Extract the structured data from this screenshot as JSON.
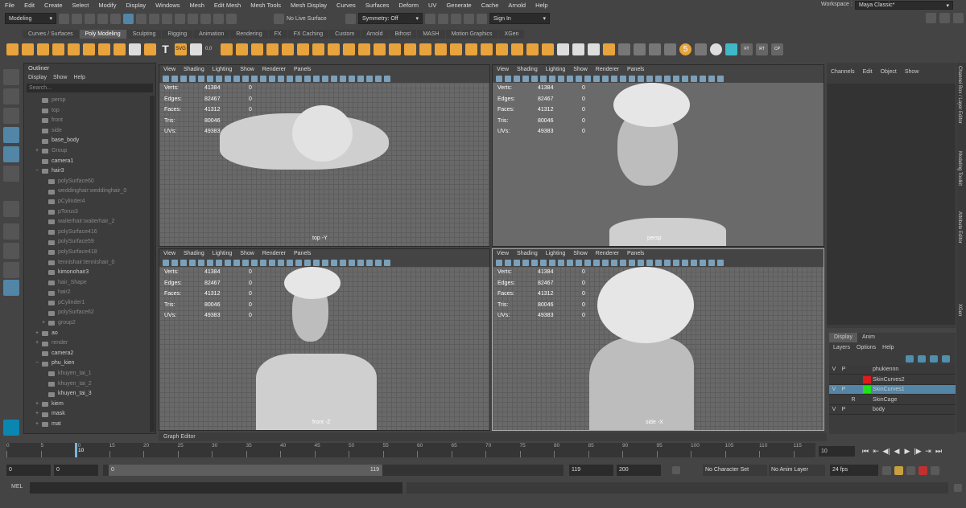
{
  "menubar": [
    "File",
    "Edit",
    "Create",
    "Select",
    "Modify",
    "Display",
    "Windows",
    "Mesh",
    "Edit Mesh",
    "Mesh Tools",
    "Mesh Display",
    "Curves",
    "Surfaces",
    "Deform",
    "UV",
    "Generate",
    "Cache",
    "Arnold",
    "Help"
  ],
  "workspace": {
    "label": "Workspace :",
    "value": "Maya Classic*"
  },
  "statusline": {
    "mode": "Modeling",
    "live_surface": "No Live Surface",
    "symmetry": "Symmetry: Off",
    "signin": "Sign In"
  },
  "shelf_tabs": [
    {
      "label": "Curves / Surfaces",
      "active": false
    },
    {
      "label": "Poly Modeling",
      "active": true
    },
    {
      "label": "Sculpting",
      "active": false
    },
    {
      "label": "Rigging",
      "active": false
    },
    {
      "label": "Animation",
      "active": false
    },
    {
      "label": "Rendering",
      "active": false
    },
    {
      "label": "FX",
      "active": false
    },
    {
      "label": "FX Caching",
      "active": false
    },
    {
      "label": "Custom",
      "active": false
    },
    {
      "label": "Arnold",
      "active": false
    },
    {
      "label": "Bifrost",
      "active": false
    },
    {
      "label": "MASH",
      "active": false
    },
    {
      "label": "Motion Graphics",
      "active": false
    },
    {
      "label": "XGen",
      "active": false
    }
  ],
  "shelf_text": {
    "svg": "SVG",
    "num": "0,0",
    "five": "5",
    "ft": "FT",
    "rt": "RT",
    "cp": "CP"
  },
  "outliner": {
    "title": "Outliner",
    "menu": [
      "Display",
      "Show",
      "Help"
    ],
    "search_placeholder": "Search...",
    "items": [
      {
        "label": "persp",
        "indent": 1,
        "dim": true,
        "expand": ""
      },
      {
        "label": "top",
        "indent": 1,
        "dim": true,
        "expand": ""
      },
      {
        "label": "front",
        "indent": 1,
        "dim": true,
        "expand": ""
      },
      {
        "label": "side",
        "indent": 1,
        "dim": true,
        "expand": ""
      },
      {
        "label": "base_body",
        "indent": 1,
        "dim": false,
        "expand": ""
      },
      {
        "label": "Group",
        "indent": 1,
        "dim": true,
        "expand": "+"
      },
      {
        "label": "camera1",
        "indent": 1,
        "dim": false,
        "expand": ""
      },
      {
        "label": "hair3",
        "indent": 1,
        "dim": false,
        "expand": "−"
      },
      {
        "label": "polySurface60",
        "indent": 2,
        "dim": true,
        "expand": ""
      },
      {
        "label": "weddinghair:weddinghair_0",
        "indent": 2,
        "dim": true,
        "expand": ""
      },
      {
        "label": "pCylinder4",
        "indent": 2,
        "dim": true,
        "expand": ""
      },
      {
        "label": "pTorus3",
        "indent": 2,
        "dim": true,
        "expand": ""
      },
      {
        "label": "waiterhair:waiterhair_2",
        "indent": 2,
        "dim": true,
        "expand": ""
      },
      {
        "label": "polySurface416",
        "indent": 2,
        "dim": true,
        "expand": ""
      },
      {
        "label": "polySurface59",
        "indent": 2,
        "dim": true,
        "expand": ""
      },
      {
        "label": "polySurface418",
        "indent": 2,
        "dim": true,
        "expand": ""
      },
      {
        "label": "tennishair:tennishair_0",
        "indent": 2,
        "dim": true,
        "expand": ""
      },
      {
        "label": "kimonohair3",
        "indent": 2,
        "dim": false,
        "expand": ""
      },
      {
        "label": "hair_Shape",
        "indent": 2,
        "dim": true,
        "expand": ""
      },
      {
        "label": "hair2",
        "indent": 2,
        "dim": true,
        "expand": ""
      },
      {
        "label": "pCylinder1",
        "indent": 2,
        "dim": true,
        "expand": ""
      },
      {
        "label": "polySurface62",
        "indent": 2,
        "dim": true,
        "expand": ""
      },
      {
        "label": "group2",
        "indent": 2,
        "dim": true,
        "expand": "+"
      },
      {
        "label": "ao",
        "indent": 1,
        "dim": false,
        "expand": "+"
      },
      {
        "label": "render",
        "indent": 1,
        "dim": true,
        "expand": "+"
      },
      {
        "label": "camera2",
        "indent": 1,
        "dim": false,
        "expand": ""
      },
      {
        "label": "phu_kien",
        "indent": 1,
        "dim": false,
        "expand": "−"
      },
      {
        "label": "khuyen_tai_1",
        "indent": 2,
        "dim": true,
        "expand": ""
      },
      {
        "label": "khuyen_tai_2",
        "indent": 2,
        "dim": true,
        "expand": ""
      },
      {
        "label": "khuyen_tai_3",
        "indent": 2,
        "dim": false,
        "expand": ""
      },
      {
        "label": "kiem",
        "indent": 1,
        "dim": false,
        "expand": "+"
      },
      {
        "label": "mask",
        "indent": 1,
        "dim": false,
        "expand": "+"
      },
      {
        "label": "mat",
        "indent": 1,
        "dim": false,
        "expand": "+"
      }
    ]
  },
  "viewport_menu": [
    "View",
    "Shading",
    "Lighting",
    "Show",
    "Renderer",
    "Panels"
  ],
  "stats": [
    {
      "key": "Verts:",
      "value": "41384",
      "sel": "0"
    },
    {
      "key": "Edges:",
      "value": "82467",
      "sel": "0"
    },
    {
      "key": "Faces:",
      "value": "41312",
      "sel": "0"
    },
    {
      "key": "Tris:",
      "value": "80046",
      "sel": "0"
    },
    {
      "key": "UVs:",
      "value": "49383",
      "sel": "0"
    }
  ],
  "viewports": {
    "top": "top -Y",
    "persp": "persp",
    "front": "front -Z",
    "side": "side -X"
  },
  "channels": {
    "menu": [
      "Channels",
      "Edit",
      "Object",
      "Show"
    ]
  },
  "side_tabs": [
    "Channel Box / Layer Editor",
    "Modeling Toolkit",
    "Attribute Editor",
    "XGen"
  ],
  "layers": {
    "tabs": [
      {
        "label": "Display",
        "active": true
      },
      {
        "label": "Anim",
        "active": false
      }
    ],
    "menu": [
      "Layers",
      "Options",
      "Help"
    ],
    "rows": [
      {
        "v": "V",
        "p": "P",
        "r": "",
        "color": "",
        "name": "phukiennn",
        "selected": false
      },
      {
        "v": "",
        "p": "",
        "r": "",
        "color": "#e01b1b",
        "name": "SkinCurves2",
        "selected": false
      },
      {
        "v": "V",
        "p": "P",
        "r": "",
        "color": "#22e01b",
        "name": "SkinCurves1",
        "selected": true
      },
      {
        "v": "",
        "p": "",
        "r": "R",
        "color": "",
        "name": "SkinCage",
        "selected": false
      },
      {
        "v": "V",
        "p": "P",
        "r": "",
        "color": "",
        "name": "body",
        "selected": false
      }
    ]
  },
  "graph_editor": "Graph Editor",
  "timeline": {
    "ticks": [
      "0",
      "5",
      "10",
      "15",
      "20",
      "25",
      "30",
      "35",
      "40",
      "45",
      "50",
      "55",
      "60",
      "65",
      "70",
      "75",
      "80",
      "85",
      "90",
      "95",
      "100",
      "105",
      "110",
      "115"
    ],
    "current": "10"
  },
  "range": {
    "start": "0",
    "anim_start": "0",
    "slider_start": "0",
    "slider_end": "119",
    "anim_end": "119",
    "end": "200",
    "character_set": "No Character Set",
    "anim_layer": "No Anim Layer",
    "fps": "24 fps"
  },
  "mel": "MEL"
}
